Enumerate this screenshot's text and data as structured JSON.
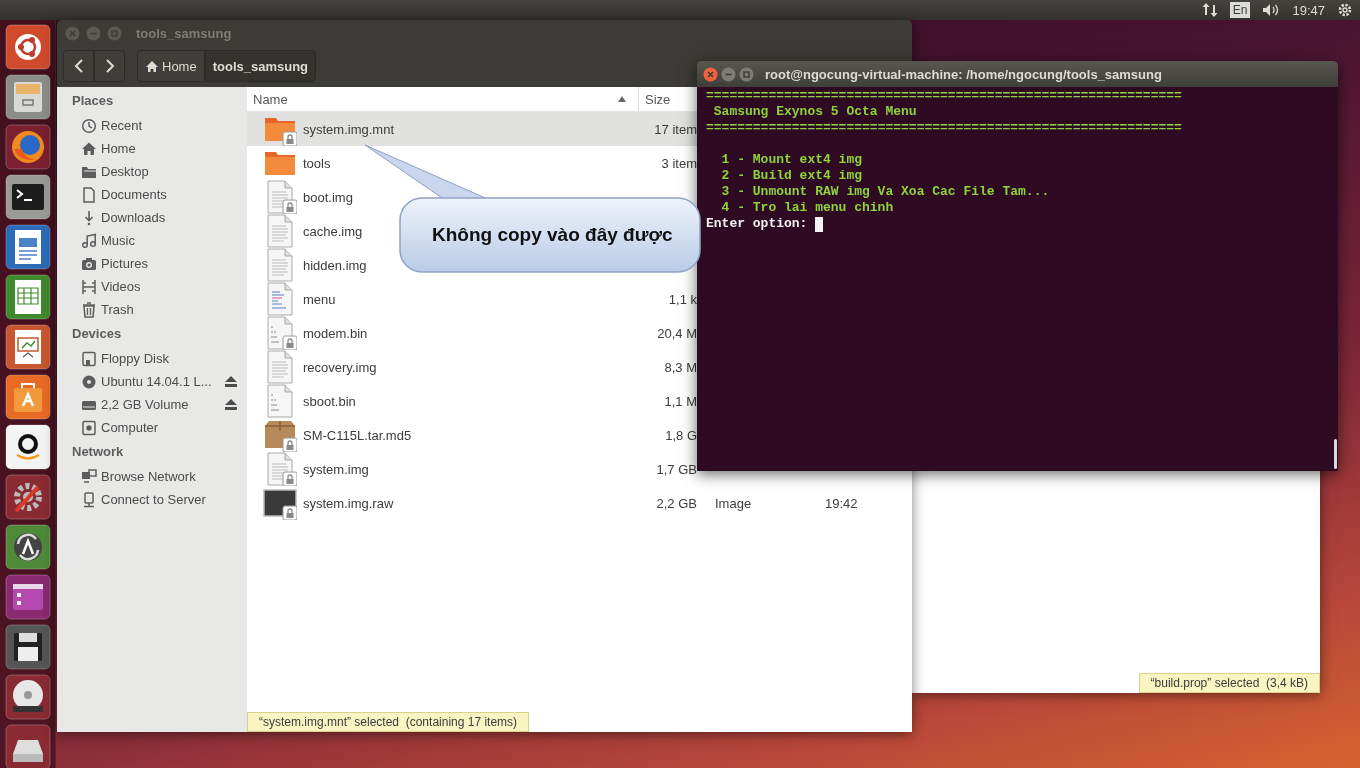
{
  "top_panel": {
    "keyboard_layout": "En",
    "clock": "19:47"
  },
  "file_manager": {
    "window": {
      "title": "tools_samsung"
    },
    "breadcrumbs": [
      {
        "label": "Home",
        "selected": false
      },
      {
        "label": "tools_samsung",
        "selected": true
      }
    ],
    "sidebar": {
      "sections": [
        {
          "title": "Places",
          "items": [
            {
              "label": "Recent",
              "eject": false,
              "selected": false
            },
            {
              "label": "Home",
              "eject": false,
              "selected": false
            },
            {
              "label": "Desktop",
              "eject": false,
              "selected": false
            },
            {
              "label": "Documents",
              "eject": false,
              "selected": false
            },
            {
              "label": "Downloads",
              "eject": false,
              "selected": false
            },
            {
              "label": "Music",
              "eject": false,
              "selected": false
            },
            {
              "label": "Pictures",
              "eject": false,
              "selected": false
            },
            {
              "label": "Videos",
              "eject": false,
              "selected": false
            },
            {
              "label": "Trash",
              "eject": false,
              "selected": false
            }
          ]
        },
        {
          "title": "Devices",
          "items": [
            {
              "label": "Floppy Disk",
              "eject": false,
              "selected": false
            },
            {
              "label": "Ubuntu 14.04.1 L...",
              "eject": true,
              "selected": false
            },
            {
              "label": "2,2 GB Volume",
              "eject": true,
              "selected": false
            },
            {
              "label": "Computer",
              "eject": false,
              "selected": false
            }
          ]
        },
        {
          "title": "Network",
          "items": [
            {
              "label": "Browse Network",
              "eject": false,
              "selected": false
            },
            {
              "label": "Connect to Server",
              "eject": false,
              "selected": false
            }
          ]
        }
      ]
    },
    "columns": [
      {
        "label": "Name",
        "sorted": true
      },
      {
        "label": "Size",
        "sorted": false
      }
    ],
    "files": [
      {
        "name": "system.img.mnt",
        "kind": "folder",
        "locked": true,
        "size": "17 item",
        "selected": true
      },
      {
        "name": "tools",
        "kind": "folder",
        "locked": false,
        "size": "3 item",
        "selected": false
      },
      {
        "name": "boot.img",
        "kind": "text",
        "locked": true,
        "selected": false
      },
      {
        "name": "cache.img",
        "kind": "text",
        "locked": false,
        "selected": false
      },
      {
        "name": "hidden.img",
        "kind": "text",
        "locked": false,
        "selected": false
      },
      {
        "name": "menu",
        "kind": "script",
        "locked": false,
        "size": "1,1 k",
        "selected": false
      },
      {
        "name": "modem.bin",
        "kind": "binary",
        "locked": true,
        "size": "20,4 M",
        "selected": false
      },
      {
        "name": "recovery.img",
        "kind": "text",
        "locked": false,
        "size": "8,3 M",
        "selected": false
      },
      {
        "name": "sboot.bin",
        "kind": "binary",
        "locked": false,
        "size": "1,1 M",
        "selected": false
      },
      {
        "name": "SM-C115L.tar.md5",
        "kind": "archive",
        "locked": true,
        "size": "1,8 G",
        "selected": false
      },
      {
        "name": "system.img",
        "kind": "text",
        "locked": true,
        "size": "1,7 GB",
        "selected": false
      },
      {
        "name": "system.img.raw",
        "kind": "disk-image",
        "locked": true,
        "size": "2,2 GB",
        "type": "Image",
        "modified": "19:42",
        "selected": false
      }
    ],
    "status": "“system.img.mnt” selected  (containing 17 items)"
  },
  "terminal": {
    "window": {
      "title": "root@ngocung-virtual-machine: /home/ngocung/tools_samsung"
    },
    "lines": [
      {
        "kind": "rule",
        "text": "============================================================="
      },
      {
        "kind": "heading",
        "text": "Samsung Exynos 5 Octa Menu"
      },
      {
        "kind": "rule",
        "text": "============================================================="
      },
      {
        "kind": "blank"
      },
      {
        "kind": "item",
        "text": "1 - Mount ext4 img"
      },
      {
        "kind": "item",
        "text": "2 - Build ext4 img"
      },
      {
        "kind": "item",
        "text": "3 - Unmount RAW img Va Xoa Cac File Tam..."
      },
      {
        "kind": "item",
        "text": "4 - Tro lai menu chinh"
      },
      {
        "kind": "prompt",
        "text": "Enter option:"
      }
    ]
  },
  "callout": {
    "text": "Không copy vào đây được"
  },
  "background_window": {
    "status": "“build.prop” selected  (3,4 kB)"
  }
}
